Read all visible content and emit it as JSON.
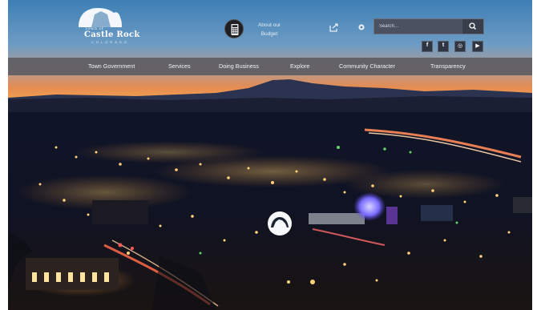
{
  "site": {
    "logo": {
      "town_of": "Town of",
      "name": "Castle Rock",
      "state": "COLORADO"
    }
  },
  "header": {
    "budget": {
      "label": "About our Budget",
      "icon": "calculator-icon"
    },
    "share_icon": "share-icon",
    "settings_icon": "gear-icon",
    "search": {
      "placeholder": "Search...",
      "icon": "search-icon"
    },
    "social": [
      {
        "name": "facebook",
        "glyph": "f"
      },
      {
        "name": "twitter",
        "glyph": "t"
      },
      {
        "name": "instagram",
        "glyph": "◎"
      },
      {
        "name": "youtube",
        "glyph": "▶"
      }
    ]
  },
  "nav": {
    "items": [
      "Town Government",
      "Services",
      "Doing Business",
      "Explore",
      "Community Character",
      "Transparency"
    ]
  },
  "colors": {
    "sky_top": "#4a86b8",
    "sunset": "#e7905a",
    "nav_bg": "#5a5a60",
    "search_bg": "#4a5160"
  }
}
